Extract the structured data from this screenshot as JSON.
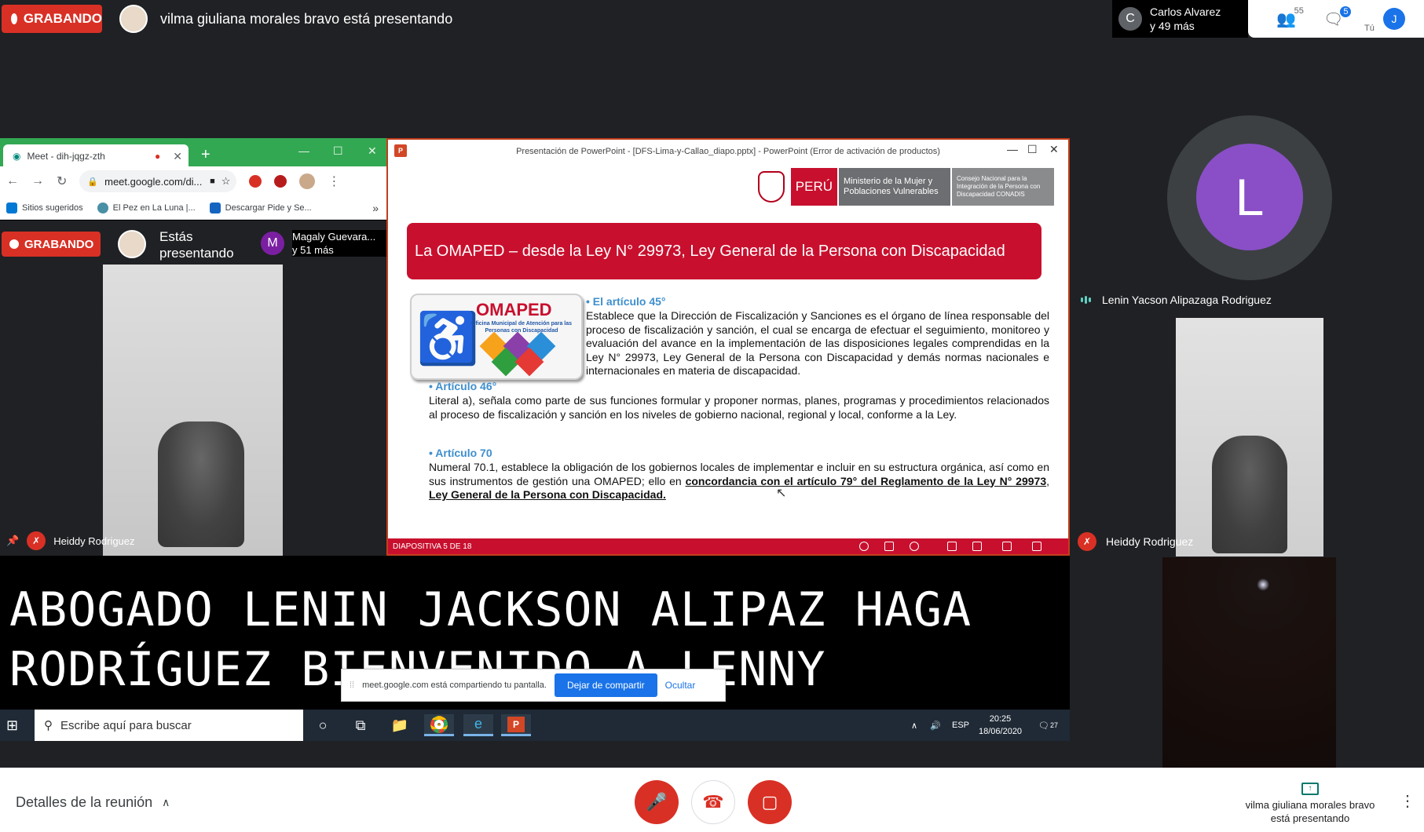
{
  "top_bar": {
    "rec_label": "GRABANDO",
    "presenter_text": "vilma giuliana morales bravo está presentando",
    "people_initial": "C",
    "people_line1": "Carlos Alvarez",
    "people_line2": "y 49 más",
    "participants_count": "55",
    "chat_count": "5",
    "self_initial": "J",
    "self_label": "Tú"
  },
  "chrome": {
    "tab_title": "Meet - dih-jqgz-zth",
    "url": "meet.google.com/di...",
    "bookmarks": [
      "Sitios sugeridos",
      "El Pez en La Luna |...",
      "Descargar Pide y Se..."
    ],
    "bookmark_more": "»"
  },
  "inner_meet": {
    "rec_label": "GRABANDO",
    "presenting_line1": "Estás",
    "presenting_line2": "presentando",
    "people_initial": "M",
    "people_line1": "Magaly Guevara...",
    "people_line2": "y 51 más",
    "participant_name": "Heiddy Rodriguez"
  },
  "ppt": {
    "window_title": "Presentación de PowerPoint - [DFS-Lima-y-Callao_diapo.pptx] - PowerPoint (Error de activación de productos)",
    "peru": "PERÚ",
    "ministry": "Ministerio de la Mujer y Poblaciones Vulnerables",
    "conadis": "Consejo Nacional para la Integración de la Persona con Discapacidad CONADIS",
    "slide_title": "La OMAPED – desde la Ley N° 29973, Ley General de la Persona con Discapacidad",
    "omaped_title": "OMAPED",
    "omaped_sub": "Oficina Municipal de Atención para las Personas con Discapacidad",
    "art45_head": "• El artículo 45°",
    "art45_body": "Establece que la Dirección de Fiscalización y Sanciones es el órgano de línea responsable del proceso de fiscalización y sanción, el cual se encarga de efectuar el seguimiento, monitoreo y evaluación del avance en la implementación de las disposiciones legales comprendidas en la Ley N° 29973, Ley General de la Persona con Discapacidad y demás normas nacionales e internacionales en materia de discapacidad.",
    "art46_head": "• Artículo 46°",
    "art46_body": "Literal a), señala como parte de sus funciones formular  y proponer normas, planes, programas y procedimientos relacionados al proceso de fiscalización y sanción en los niveles de gobierno nacional, regional y local, conforme a la Ley.",
    "art70_head": "• Artículo 70",
    "art70_body": "Numeral 70.1, establece la obligación de los gobiernos locales de implementar e incluir en su estructura orgánica, así como en sus instrumentos de gestión una OMAPED; ello en ",
    "art70_bold1": "concordancia con el artículo 79° del Reglamento de la Ley N° 29973",
    "art70_sep": ", ",
    "art70_bold2": "Ley General de la Persona con Discapacidad.",
    "status": "DIAPOSITIVA 5 DE 18"
  },
  "caption": {
    "line1": "ABOGADO LENIN JACKSON ALIPAZ HAGA",
    "line2": "RODRÍGUEZ BIENVENIDO A LENNY"
  },
  "share_popup": {
    "text": "meet.google.com está compartiendo tu pantalla.",
    "stop": "Dejar de compartir",
    "hide": "Ocultar"
  },
  "taskbar": {
    "search_placeholder": "Escribe aquí para buscar",
    "lang": "ESP",
    "time": "20:25",
    "date": "18/06/2020",
    "notif_count": "27"
  },
  "right_panel": {
    "lenin_initial": "L",
    "lenin_name": "Lenin Yacson Alipazaga Rodriguez",
    "heiddy_name": "Heiddy Rodriguez"
  },
  "bottom_bar": {
    "details": "Detalles de la reunión",
    "presenter_line1": "vilma giuliana morales bravo",
    "presenter_line2": "está presentando"
  },
  "colors": {
    "meet_red": "#d93025",
    "slide_red": "#c8102e",
    "chrome_green": "#32a852"
  }
}
